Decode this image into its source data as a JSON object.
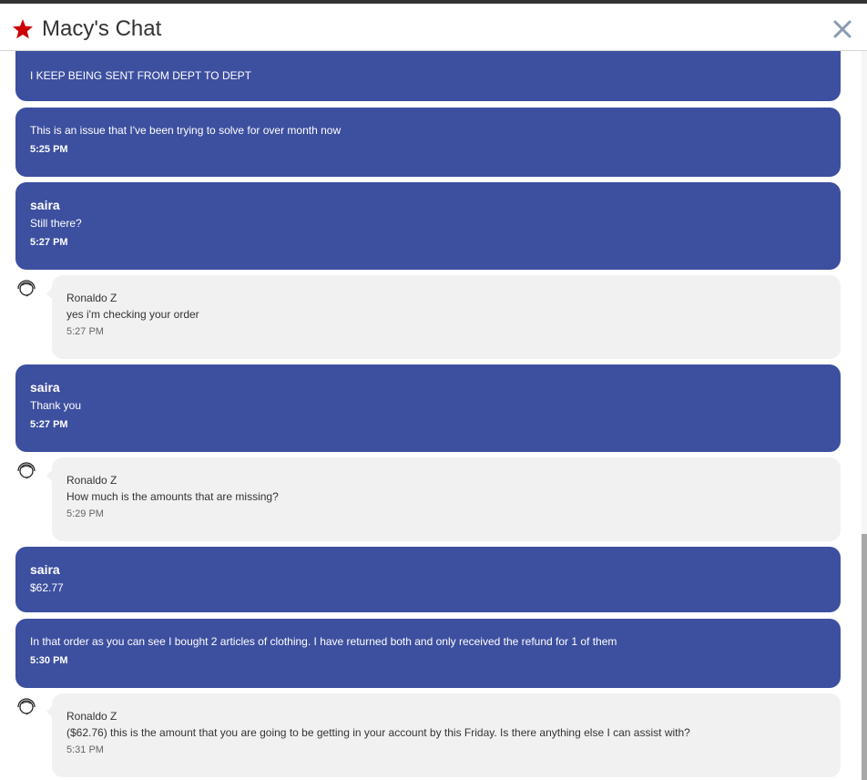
{
  "header": {
    "title": "Macy's Chat",
    "brand_color": "#cc0000",
    "close_icon": "close-icon"
  },
  "colors": {
    "user_bubble": "#3d4f9f",
    "agent_bubble": "#f1f1f1"
  },
  "messages": [
    {
      "type": "user",
      "text": "I KEEP BEING SENT FROM DEPT TO DEPT"
    },
    {
      "type": "user",
      "text": "This is an issue that I've been trying to solve for over month now",
      "time": "5:25 PM"
    },
    {
      "type": "user",
      "sender": "saira",
      "text": "Still there?",
      "time": "5:27 PM"
    },
    {
      "type": "agent",
      "sender": "Ronaldo Z",
      "text": "yes i'm checking your order",
      "time": "5:27 PM"
    },
    {
      "type": "user",
      "sender": "saira",
      "text": "Thank you",
      "time": "5:27 PM"
    },
    {
      "type": "agent",
      "sender": "Ronaldo Z",
      "text": "How much is the amounts that are missing?",
      "time": "5:29 PM"
    },
    {
      "type": "user",
      "sender": "saira",
      "text": "$62.77"
    },
    {
      "type": "user",
      "text": "In that order as you can see I bought 2 articles of clothing. I have returned both and only received the refund for 1 of them",
      "time": "5:30 PM"
    },
    {
      "type": "agent",
      "sender": "Ronaldo Z",
      "text": "($62.76) this is the amount that you are going to be getting in your account by this Friday. Is there anything else I can assist with?",
      "time": "5:31 PM"
    }
  ]
}
